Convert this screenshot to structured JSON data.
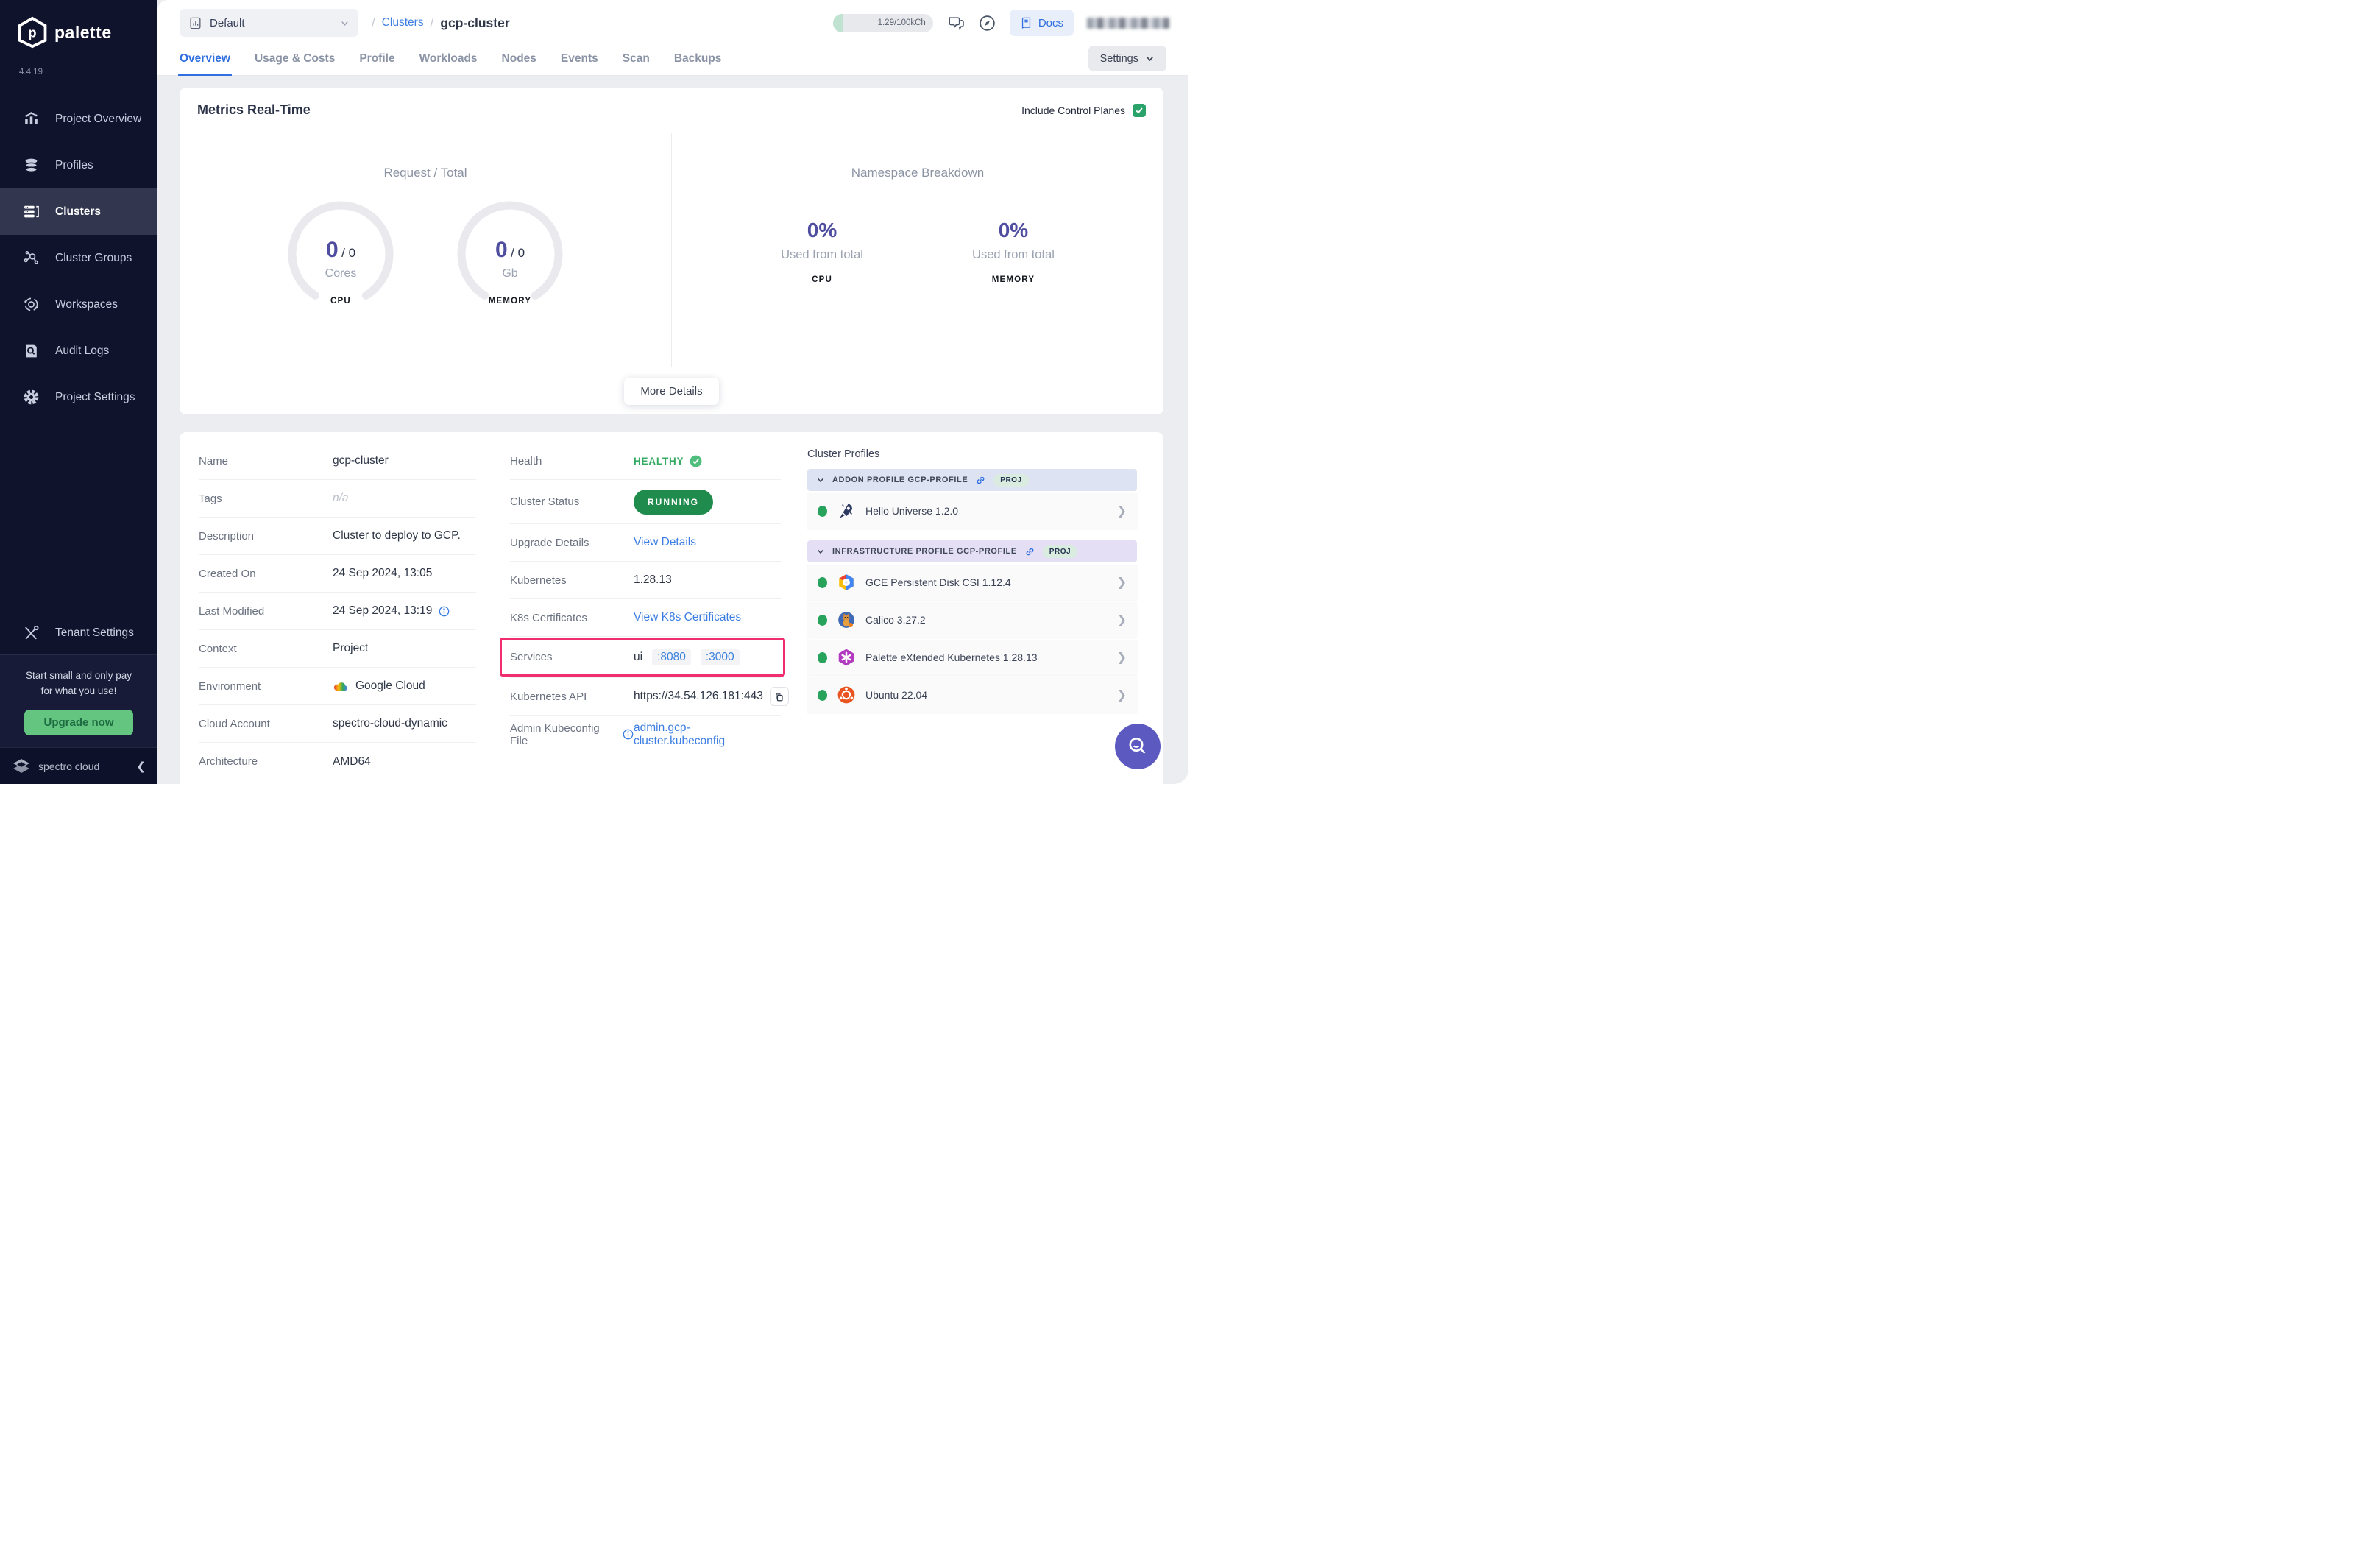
{
  "app": {
    "brand": "palette",
    "version": "4.4.19",
    "footer_brand": "spectro cloud"
  },
  "sidebar": {
    "items": [
      {
        "label": "Project Overview",
        "icon": "bar-chart-icon"
      },
      {
        "label": "Profiles",
        "icon": "layers-icon"
      },
      {
        "label": "Clusters",
        "icon": "server-icon",
        "active": true
      },
      {
        "label": "Cluster Groups",
        "icon": "network-icon"
      },
      {
        "label": "Workspaces",
        "icon": "orbit-icon"
      },
      {
        "label": "Audit Logs",
        "icon": "audit-doc-icon"
      },
      {
        "label": "Project Settings",
        "icon": "gear-icon"
      },
      {
        "label": "Tenant Settings",
        "icon": "tools-icon"
      }
    ],
    "promo": {
      "line1": "Start small and only pay",
      "line2": "for what you use!",
      "cta": "Upgrade now"
    }
  },
  "topbar": {
    "project_selector": "Default",
    "breadcrumb": {
      "sep1": "/",
      "section": "Clusters",
      "sep2": "/",
      "current": "gcp-cluster"
    },
    "usage_pill": "1.29/100kCh",
    "docs_button": "Docs"
  },
  "tabs": [
    {
      "label": "Overview"
    },
    {
      "label": "Usage & Costs"
    },
    {
      "label": "Profile"
    },
    {
      "label": "Workloads"
    },
    {
      "label": "Nodes"
    },
    {
      "label": "Events"
    },
    {
      "label": "Scan"
    },
    {
      "label": "Backups"
    }
  ],
  "active_tab": "Overview",
  "settings_button": "Settings",
  "metrics": {
    "title": "Metrics Real-Time",
    "include_control_planes": "Include Control Planes",
    "include_control_planes_checked": true,
    "request_total": {
      "title": "Request / Total",
      "gauges": [
        {
          "value": "0",
          "sep": "/",
          "total": "0",
          "unit": "Cores",
          "caption": "CPU"
        },
        {
          "value": "0",
          "sep": "/",
          "total": "0",
          "unit": "Gb",
          "caption": "MEMORY"
        }
      ]
    },
    "namespace_breakdown": {
      "title": "Namespace Breakdown",
      "stats": [
        {
          "value": "0%",
          "label": "Used from total",
          "caption": "CPU"
        },
        {
          "value": "0%",
          "label": "Used from total",
          "caption": "MEMORY"
        }
      ]
    },
    "more_details_button": "More Details"
  },
  "details": {
    "left": [
      {
        "label": "Name",
        "value": "gcp-cluster"
      },
      {
        "label": "Tags",
        "value": "n/a"
      },
      {
        "label": "Description",
        "value": "Cluster to deploy to GCP."
      },
      {
        "label": "Created On",
        "value": "24 Sep 2024, 13:05"
      },
      {
        "label": "Last Modified",
        "value": "24 Sep 2024, 13:19"
      },
      {
        "label": "Context",
        "value": "Project"
      },
      {
        "label": "Environment",
        "value": "Google Cloud"
      },
      {
        "label": "Cloud Account",
        "value": "spectro-cloud-dynamic"
      },
      {
        "label": "Architecture",
        "value": "AMD64"
      }
    ],
    "middle": {
      "health": {
        "label": "Health",
        "value": "HEALTHY"
      },
      "cluster_status": {
        "label": "Cluster Status",
        "value": "RUNNING"
      },
      "upgrade": {
        "label": "Upgrade Details",
        "link": "View Details"
      },
      "kubernetes": {
        "label": "Kubernetes",
        "value": "1.28.13"
      },
      "k8s_certificates": {
        "label": "K8s Certificates",
        "link": "View K8s Certificates"
      },
      "services": {
        "label": "Services",
        "name": "ui",
        "ports": [
          {
            "label": ":8080"
          },
          {
            "label": ":3000"
          }
        ]
      },
      "kubernetes_api": {
        "label": "Kubernetes API",
        "value": "https://34.54.126.181:443"
      },
      "admin_kubeconfig": {
        "label": "Admin Kubeconfig File",
        "link": "admin.gcp-cluster.kubeconfig"
      }
    }
  },
  "cluster_profiles": {
    "title": "Cluster Profiles",
    "groups": [
      {
        "header": "ADDON PROFILE GCP-PROFILE",
        "badge": "PROJ",
        "items": [
          {
            "name": "Hello Universe 1.2.0",
            "logo": "hello-universe-logo"
          }
        ]
      },
      {
        "header": "INFRASTRUCTURE PROFILE GCP-PROFILE",
        "badge": "PROJ",
        "items": [
          {
            "name": "GCE Persistent Disk CSI 1.12.4",
            "logo": "gce-disk-logo"
          },
          {
            "name": "Calico 3.27.2",
            "logo": "calico-logo"
          },
          {
            "name": "Palette eXtended Kubernetes 1.28.13",
            "logo": "pxk-logo"
          },
          {
            "name": "Ubuntu 22.04",
            "logo": "ubuntu-logo"
          }
        ]
      }
    ]
  },
  "colors": {
    "accent_blue": "#2f6fe0",
    "metric_purple": "#4f4da0",
    "healthy_green": "#34ab63",
    "running_badge_green": "#1f8b4d",
    "highlight_pink": "#f02d6e",
    "upgrade_green": "#63c57f",
    "sidebar_navy": "#10132c"
  }
}
